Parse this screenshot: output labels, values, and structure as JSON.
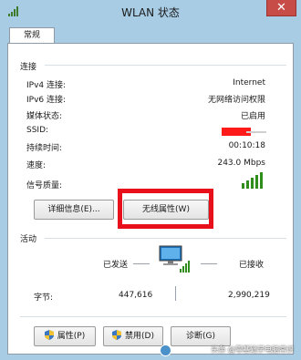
{
  "window": {
    "title": "WLAN 状态",
    "close_label": "✕"
  },
  "tabs": [
    {
      "label": "常规"
    }
  ],
  "connection": {
    "title": "连接",
    "rows": [
      {
        "label": "IPv4 连接:",
        "value": "Internet"
      },
      {
        "label": "IPv6 连接:",
        "value": "无网络访问权限"
      },
      {
        "label": "媒体状态:",
        "value": "已启用"
      },
      {
        "label": "SSID:",
        "value": ""
      },
      {
        "label": "持续时间:",
        "value": "00:10:18"
      },
      {
        "label": "速度:",
        "value": "243.0 Mbps"
      }
    ],
    "signal_label": "信号质量:",
    "signal_bars_lit": 5,
    "signal_bars_total": 5,
    "details_button": "详细信息(E)...",
    "wireless_button": "无线属性(W)"
  },
  "activity": {
    "title": "活动",
    "sent_label": "已发送",
    "received_label": "已接收",
    "bytes_label": "字节:",
    "bytes_sent": "447,616",
    "bytes_received": "2,990,219"
  },
  "actions": {
    "properties_button": "属性(P)",
    "disable_button": "禁用(D)",
    "diagnose_button": "诊断(G)"
  },
  "watermark": "头条 @零基础学电脑常识",
  "colors": {
    "titlebar": "#a8cce4",
    "close": "#c74b46",
    "highlight": "#e8101a",
    "signal": "#2f8d1c"
  }
}
